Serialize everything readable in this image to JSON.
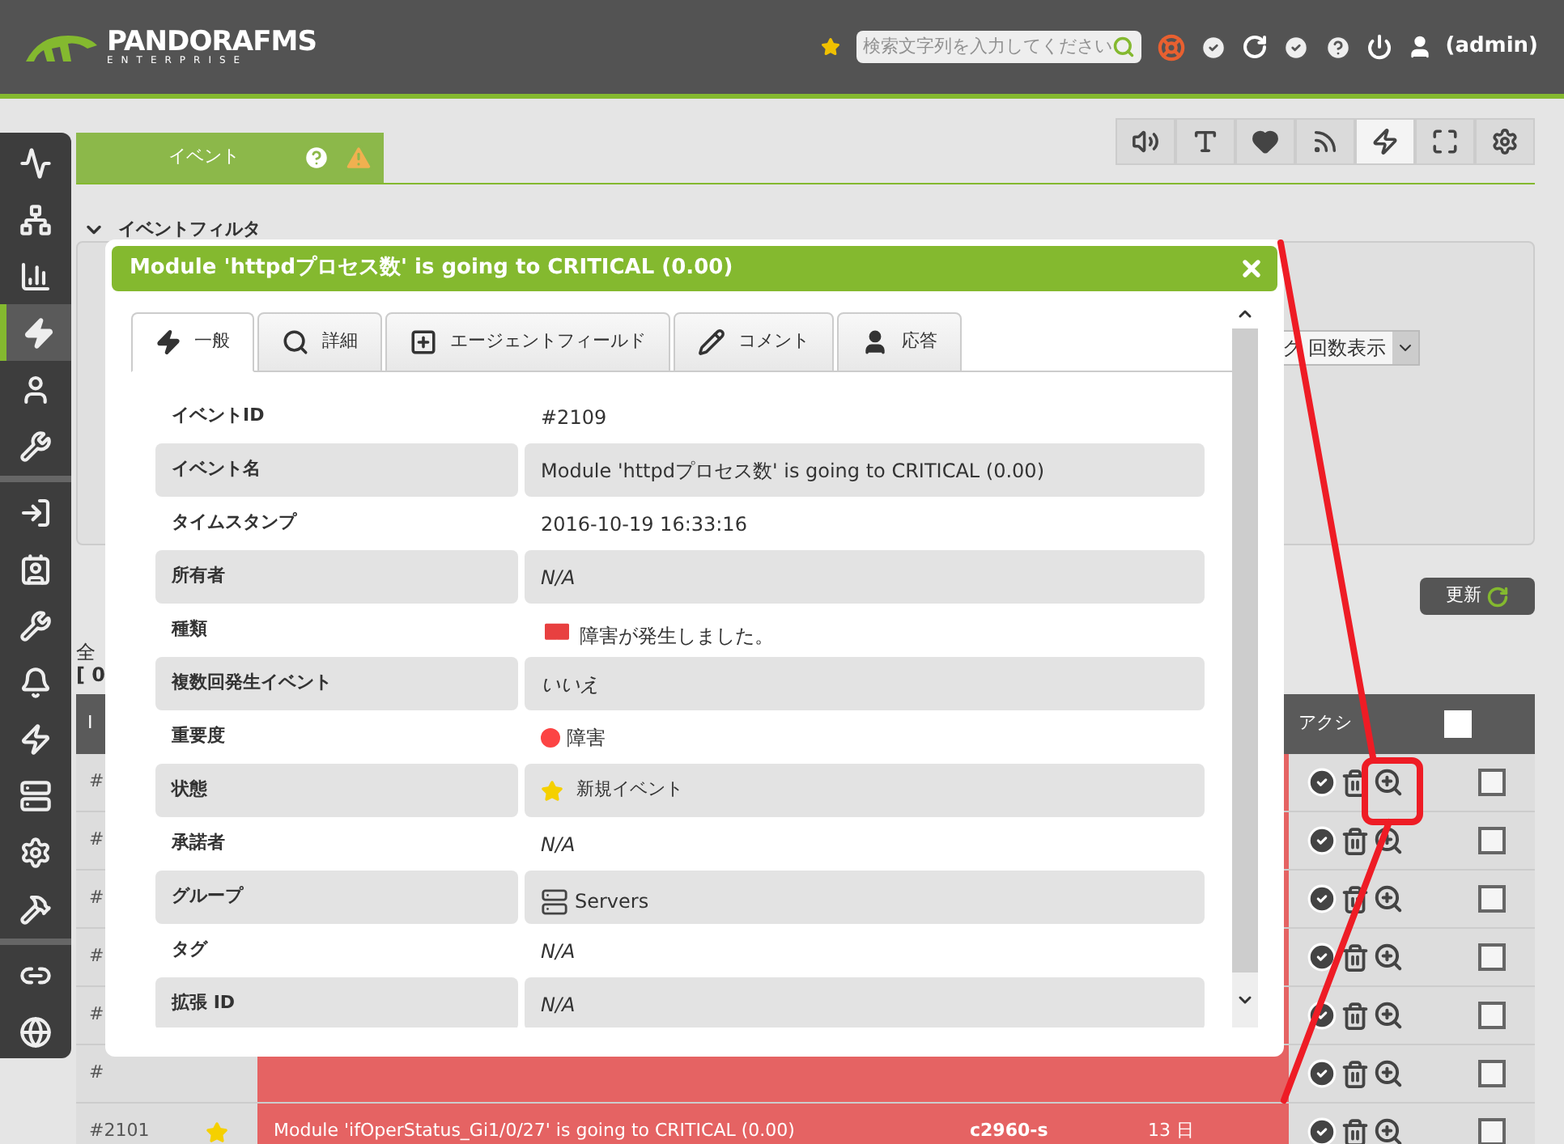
{
  "header": {
    "logo": "PANDORAFMS",
    "logo_sub": "ENTERPRISE",
    "search": {
      "placeholder": "検索文字列を入力してください"
    },
    "user": "(admin)"
  },
  "sidebar": {
    "groups": [
      {
        "items": [
          {
            "selected": false
          },
          {
            "selected": false
          },
          {
            "selected": false
          },
          {
            "selected": true
          },
          {
            "selected": false
          },
          {
            "selected": false
          }
        ]
      },
      {
        "items": [
          {
            "selected": false
          },
          {
            "selected": false
          },
          {
            "selected": false
          },
          {
            "selected": false
          },
          {
            "selected": false
          },
          {
            "selected": false
          },
          {
            "selected": false
          },
          {
            "selected": false
          }
        ]
      },
      {
        "items": [
          {
            "selected": false
          },
          {
            "selected": false
          }
        ]
      }
    ]
  },
  "page_tab": {
    "label": "イベント",
    "selected": true
  },
  "toolbar": [
    {
      "selected": false
    },
    {
      "selected": false
    },
    {
      "selected": false
    },
    {
      "selected": false
    },
    {
      "selected": true
    },
    {
      "selected": false
    },
    {
      "selected": false
    }
  ],
  "filter": {
    "title": "イベントフィルタ",
    "select_value": "ク 回数表示"
  },
  "update_button": "更新",
  "summary": [
    "全",
    "[ 0"
  ],
  "table": {
    "columns": [
      "I",
      "アクシ"
    ],
    "select_all": {
      "checked": false
    },
    "rows": [
      {
        "id": "#",
        "checked": false
      },
      {
        "id": "#",
        "checked": false
      },
      {
        "id": "#",
        "checked": false
      },
      {
        "id": "#",
        "checked": false
      },
      {
        "id": "#",
        "checked": false
      },
      {
        "id": "#",
        "checked": false
      },
      {
        "id": "#2101",
        "starred": true,
        "event": "Module 'ifOperStatus_Gi1/0/27' is going to CRITICAL (0.00)",
        "agent": "c2960-s",
        "time": "13 日",
        "checked": false
      }
    ]
  },
  "modal": {
    "title": "Module 'httpdプロセス数' is going to CRITICAL (0.00)",
    "tabs": [
      {
        "label": "一般",
        "selected": true
      },
      {
        "label": "詳細",
        "selected": false
      },
      {
        "label": "エージェントフィールド",
        "selected": false
      },
      {
        "label": "コメント",
        "selected": false
      },
      {
        "label": "応答",
        "selected": false
      }
    ],
    "rows": [
      {
        "label": "イベントID",
        "value": "#2109",
        "kind": "text"
      },
      {
        "label": "イベント名",
        "value": "Module 'httpdプロセス数' is going to CRITICAL (0.00)",
        "kind": "text"
      },
      {
        "label": "タイムスタンプ",
        "value": "2016-10-19 16:33:16",
        "kind": "text"
      },
      {
        "label": "所有者",
        "value": "N/A",
        "kind": "na"
      },
      {
        "label": "種類",
        "value": "障害が発生しました。",
        "kind": "type"
      },
      {
        "label": "複数回発生イベント",
        "value": "いいえ",
        "kind": "na"
      },
      {
        "label": "重要度",
        "value": "障害",
        "kind": "severity",
        "color": "#fc4444"
      },
      {
        "label": "状態",
        "value": "新規イベント",
        "kind": "status"
      },
      {
        "label": "承諾者",
        "value": "N/A",
        "kind": "na"
      },
      {
        "label": "グループ",
        "value": "Servers",
        "kind": "group"
      },
      {
        "label": "タグ",
        "value": "N/A",
        "kind": "na"
      },
      {
        "label": "拡張 ID",
        "value": "N/A",
        "kind": "na"
      }
    ]
  }
}
